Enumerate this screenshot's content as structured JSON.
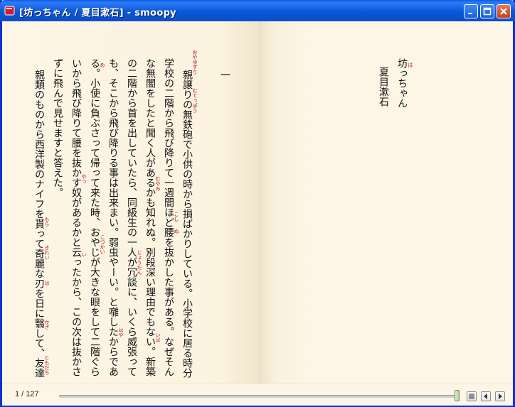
{
  "window": {
    "title": "[坊っちゃん / 夏目漱石] - smoopy"
  },
  "book": {
    "title": "坊っちゃん",
    "author": "夏目漱石",
    "title_ruby": "ぼ"
  },
  "chapter_number": "一",
  "text_columns": [
    "親譲りの無鉄砲で小供の時から損ばかりしている。小学校に居る時分",
    "学校の二階から飛び降りて一週間ほど腰を抜かした事がある。なぜそん",
    "な無闇をしたと聞く人があるかも知れぬ。別段深い理由でもない。新築",
    "の二階から首を出していたら、同級生の一人が冗談に、いくら威張って",
    "も、そこから飛び降りる事は出来まい。弱虫やーい。と囃したからであ",
    "る。小使に負ぶさって帰って来た時、おやじが大きな眼をして二階ぐら",
    "いから飛び降りて腰を抜かす奴があるかと云ったから、この次は抜かさ",
    "ずに飛んで見せますと答えた。",
    "親類のものから西洋製のナイフを貰って奇麗な刃を日に翳して、友達"
  ],
  "ruby": [
    {
      "col": 0,
      "text": "おやゆずり"
    },
    {
      "col": 0,
      "text": "むてっぽう"
    },
    {
      "col": 1,
      "text": "こし"
    },
    {
      "col": 1,
      "text": "ぬ"
    },
    {
      "col": 2,
      "text": "むやみ"
    },
    {
      "col": 2,
      "text": "いば"
    },
    {
      "col": 3,
      "text": "じょうだん"
    },
    {
      "col": 4,
      "text": "はや"
    },
    {
      "col": 5,
      "text": "こづかい"
    },
    {
      "col": 5,
      "text": "め"
    },
    {
      "col": 6,
      "text": "やつ"
    },
    {
      "col": 6,
      "text": "い"
    },
    {
      "col": 8,
      "text": "もら"
    },
    {
      "col": 8,
      "text": "きれい"
    },
    {
      "col": 8,
      "text": "は"
    },
    {
      "col": 8,
      "text": "かざ"
    },
    {
      "col": 8,
      "text": "ともだち"
    }
  ],
  "status": {
    "page_indicator": "1 / 127",
    "progress": 0.0
  },
  "colors": {
    "ruby": "#b5121b",
    "paper": "#fdf6e6",
    "titlebar": "#0a5de8"
  },
  "icons": {
    "app": "book-icon",
    "menu": "list-icon",
    "prev": "prev-page-icon",
    "next": "next-page-icon"
  }
}
